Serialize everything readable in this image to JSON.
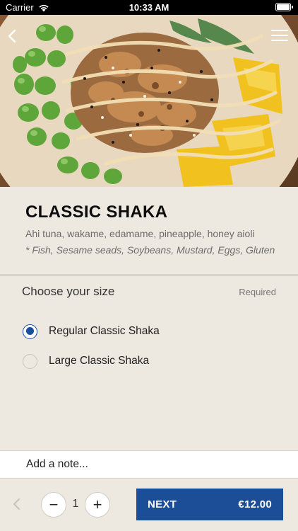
{
  "status_bar": {
    "carrier": "Carrier",
    "time": "10:33 AM"
  },
  "hero": {
    "image": "poke-bowl-photo",
    "back_icon": "chevron-left-icon",
    "menu_icon": "hamburger-menu-icon"
  },
  "item": {
    "title": "CLASSIC SHAKA",
    "description": "Ahi tuna, wakame, edamame, pineapple, honey aioli",
    "allergens": "* Fish, Sesame seads, Soybeans, Mustard, Eggs, Gluten"
  },
  "size_section": {
    "title": "Choose your size",
    "required_label": "Required",
    "options": [
      {
        "label": "Regular Classic Shaka",
        "selected": true
      },
      {
        "label": "Large Classic Shaka",
        "selected": false
      }
    ]
  },
  "note": {
    "placeholder": "Add a note..."
  },
  "footer": {
    "quantity": "1",
    "minus_label": "−",
    "plus_label": "+",
    "next_label": "NEXT",
    "price": "€12.00"
  },
  "colors": {
    "accent": "#1c4e98",
    "background": "#ede8e0"
  }
}
